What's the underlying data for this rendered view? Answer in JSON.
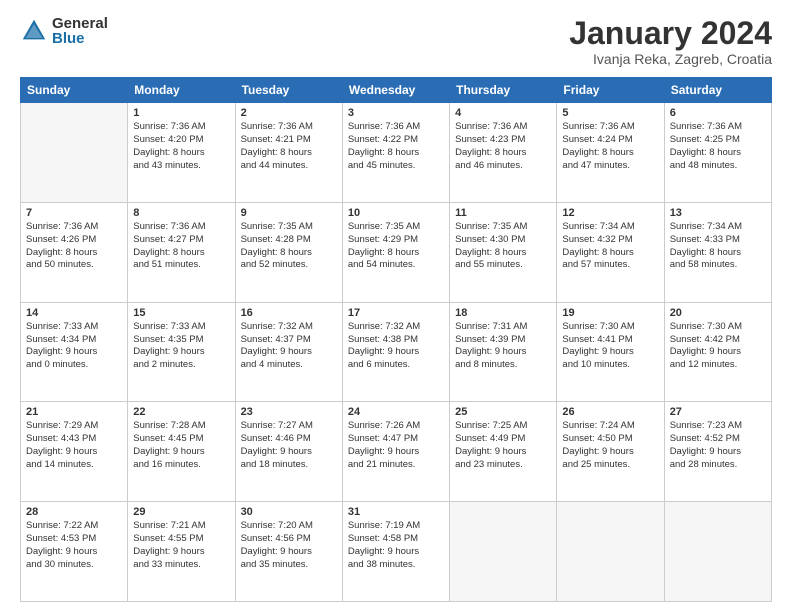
{
  "logo": {
    "general": "General",
    "blue": "Blue"
  },
  "header": {
    "month": "January 2024",
    "location": "Ivanja Reka, Zagreb, Croatia"
  },
  "weekdays": [
    "Sunday",
    "Monday",
    "Tuesday",
    "Wednesday",
    "Thursday",
    "Friday",
    "Saturday"
  ],
  "weeks": [
    [
      {
        "day": "",
        "lines": []
      },
      {
        "day": "1",
        "lines": [
          "Sunrise: 7:36 AM",
          "Sunset: 4:20 PM",
          "Daylight: 8 hours",
          "and 43 minutes."
        ]
      },
      {
        "day": "2",
        "lines": [
          "Sunrise: 7:36 AM",
          "Sunset: 4:21 PM",
          "Daylight: 8 hours",
          "and 44 minutes."
        ]
      },
      {
        "day": "3",
        "lines": [
          "Sunrise: 7:36 AM",
          "Sunset: 4:22 PM",
          "Daylight: 8 hours",
          "and 45 minutes."
        ]
      },
      {
        "day": "4",
        "lines": [
          "Sunrise: 7:36 AM",
          "Sunset: 4:23 PM",
          "Daylight: 8 hours",
          "and 46 minutes."
        ]
      },
      {
        "day": "5",
        "lines": [
          "Sunrise: 7:36 AM",
          "Sunset: 4:24 PM",
          "Daylight: 8 hours",
          "and 47 minutes."
        ]
      },
      {
        "day": "6",
        "lines": [
          "Sunrise: 7:36 AM",
          "Sunset: 4:25 PM",
          "Daylight: 8 hours",
          "and 48 minutes."
        ]
      }
    ],
    [
      {
        "day": "7",
        "lines": [
          "Sunrise: 7:36 AM",
          "Sunset: 4:26 PM",
          "Daylight: 8 hours",
          "and 50 minutes."
        ]
      },
      {
        "day": "8",
        "lines": [
          "Sunrise: 7:36 AM",
          "Sunset: 4:27 PM",
          "Daylight: 8 hours",
          "and 51 minutes."
        ]
      },
      {
        "day": "9",
        "lines": [
          "Sunrise: 7:35 AM",
          "Sunset: 4:28 PM",
          "Daylight: 8 hours",
          "and 52 minutes."
        ]
      },
      {
        "day": "10",
        "lines": [
          "Sunrise: 7:35 AM",
          "Sunset: 4:29 PM",
          "Daylight: 8 hours",
          "and 54 minutes."
        ]
      },
      {
        "day": "11",
        "lines": [
          "Sunrise: 7:35 AM",
          "Sunset: 4:30 PM",
          "Daylight: 8 hours",
          "and 55 minutes."
        ]
      },
      {
        "day": "12",
        "lines": [
          "Sunrise: 7:34 AM",
          "Sunset: 4:32 PM",
          "Daylight: 8 hours",
          "and 57 minutes."
        ]
      },
      {
        "day": "13",
        "lines": [
          "Sunrise: 7:34 AM",
          "Sunset: 4:33 PM",
          "Daylight: 8 hours",
          "and 58 minutes."
        ]
      }
    ],
    [
      {
        "day": "14",
        "lines": [
          "Sunrise: 7:33 AM",
          "Sunset: 4:34 PM",
          "Daylight: 9 hours",
          "and 0 minutes."
        ]
      },
      {
        "day": "15",
        "lines": [
          "Sunrise: 7:33 AM",
          "Sunset: 4:35 PM",
          "Daylight: 9 hours",
          "and 2 minutes."
        ]
      },
      {
        "day": "16",
        "lines": [
          "Sunrise: 7:32 AM",
          "Sunset: 4:37 PM",
          "Daylight: 9 hours",
          "and 4 minutes."
        ]
      },
      {
        "day": "17",
        "lines": [
          "Sunrise: 7:32 AM",
          "Sunset: 4:38 PM",
          "Daylight: 9 hours",
          "and 6 minutes."
        ]
      },
      {
        "day": "18",
        "lines": [
          "Sunrise: 7:31 AM",
          "Sunset: 4:39 PM",
          "Daylight: 9 hours",
          "and 8 minutes."
        ]
      },
      {
        "day": "19",
        "lines": [
          "Sunrise: 7:30 AM",
          "Sunset: 4:41 PM",
          "Daylight: 9 hours",
          "and 10 minutes."
        ]
      },
      {
        "day": "20",
        "lines": [
          "Sunrise: 7:30 AM",
          "Sunset: 4:42 PM",
          "Daylight: 9 hours",
          "and 12 minutes."
        ]
      }
    ],
    [
      {
        "day": "21",
        "lines": [
          "Sunrise: 7:29 AM",
          "Sunset: 4:43 PM",
          "Daylight: 9 hours",
          "and 14 minutes."
        ]
      },
      {
        "day": "22",
        "lines": [
          "Sunrise: 7:28 AM",
          "Sunset: 4:45 PM",
          "Daylight: 9 hours",
          "and 16 minutes."
        ]
      },
      {
        "day": "23",
        "lines": [
          "Sunrise: 7:27 AM",
          "Sunset: 4:46 PM",
          "Daylight: 9 hours",
          "and 18 minutes."
        ]
      },
      {
        "day": "24",
        "lines": [
          "Sunrise: 7:26 AM",
          "Sunset: 4:47 PM",
          "Daylight: 9 hours",
          "and 21 minutes."
        ]
      },
      {
        "day": "25",
        "lines": [
          "Sunrise: 7:25 AM",
          "Sunset: 4:49 PM",
          "Daylight: 9 hours",
          "and 23 minutes."
        ]
      },
      {
        "day": "26",
        "lines": [
          "Sunrise: 7:24 AM",
          "Sunset: 4:50 PM",
          "Daylight: 9 hours",
          "and 25 minutes."
        ]
      },
      {
        "day": "27",
        "lines": [
          "Sunrise: 7:23 AM",
          "Sunset: 4:52 PM",
          "Daylight: 9 hours",
          "and 28 minutes."
        ]
      }
    ],
    [
      {
        "day": "28",
        "lines": [
          "Sunrise: 7:22 AM",
          "Sunset: 4:53 PM",
          "Daylight: 9 hours",
          "and 30 minutes."
        ]
      },
      {
        "day": "29",
        "lines": [
          "Sunrise: 7:21 AM",
          "Sunset: 4:55 PM",
          "Daylight: 9 hours",
          "and 33 minutes."
        ]
      },
      {
        "day": "30",
        "lines": [
          "Sunrise: 7:20 AM",
          "Sunset: 4:56 PM",
          "Daylight: 9 hours",
          "and 35 minutes."
        ]
      },
      {
        "day": "31",
        "lines": [
          "Sunrise: 7:19 AM",
          "Sunset: 4:58 PM",
          "Daylight: 9 hours",
          "and 38 minutes."
        ]
      },
      {
        "day": "",
        "lines": []
      },
      {
        "day": "",
        "lines": []
      },
      {
        "day": "",
        "lines": []
      }
    ]
  ]
}
